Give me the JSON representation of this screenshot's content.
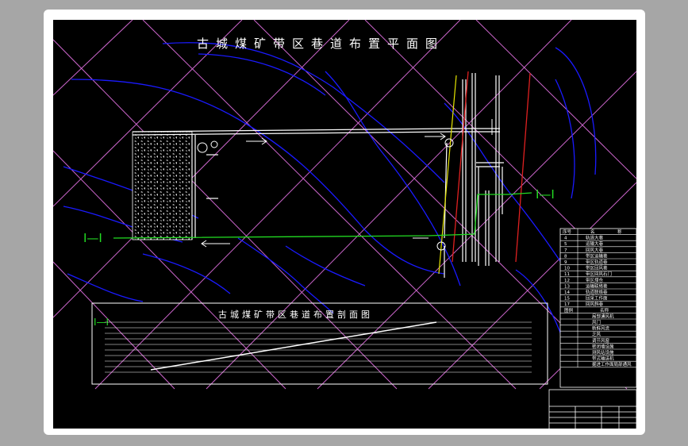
{
  "plan": {
    "title": "古城煤矿带区巷道布置平面图",
    "section_marker": "I—I"
  },
  "section": {
    "title": "古城煤矿带区巷道布置剖面图",
    "marker": "I—I"
  },
  "legend": {
    "header": [
      "序号",
      "名",
      "称"
    ],
    "rows": [
      {
        "no": "4",
        "name": "轨道大巷"
      },
      {
        "no": "5",
        "name": "运输大巷"
      },
      {
        "no": "7",
        "name": "回风大巷"
      },
      {
        "no": "8",
        "name": "带区运输巷"
      },
      {
        "no": "9",
        "name": "带区轨道巷"
      },
      {
        "no": "10",
        "name": "带区回风巷"
      },
      {
        "no": "11",
        "name": "带区回风石门"
      },
      {
        "no": "12",
        "name": "带区煤仓"
      },
      {
        "no": "13",
        "name": "运输联络巷"
      },
      {
        "no": "14",
        "name": "轨道联络巷"
      },
      {
        "no": "15",
        "name": "回采工作面"
      },
      {
        "no": "17",
        "name": "回风斜巷"
      }
    ],
    "symbol_header": [
      "图例",
      "名称"
    ],
    "symbols": [
      "局部通风机",
      "风门",
      "新鲜风流",
      "乏风",
      "调节风窗",
      "密闭墙设施",
      "测风站设施",
      "带式输送机",
      "掘进工作面局部通风"
    ]
  },
  "colors": {
    "background": "#000000",
    "contour": "#1a1aff",
    "grid": "#cc66cc",
    "section_line": "#22dd22",
    "fault": "#e02020",
    "yellow_line": "#e6e600"
  }
}
